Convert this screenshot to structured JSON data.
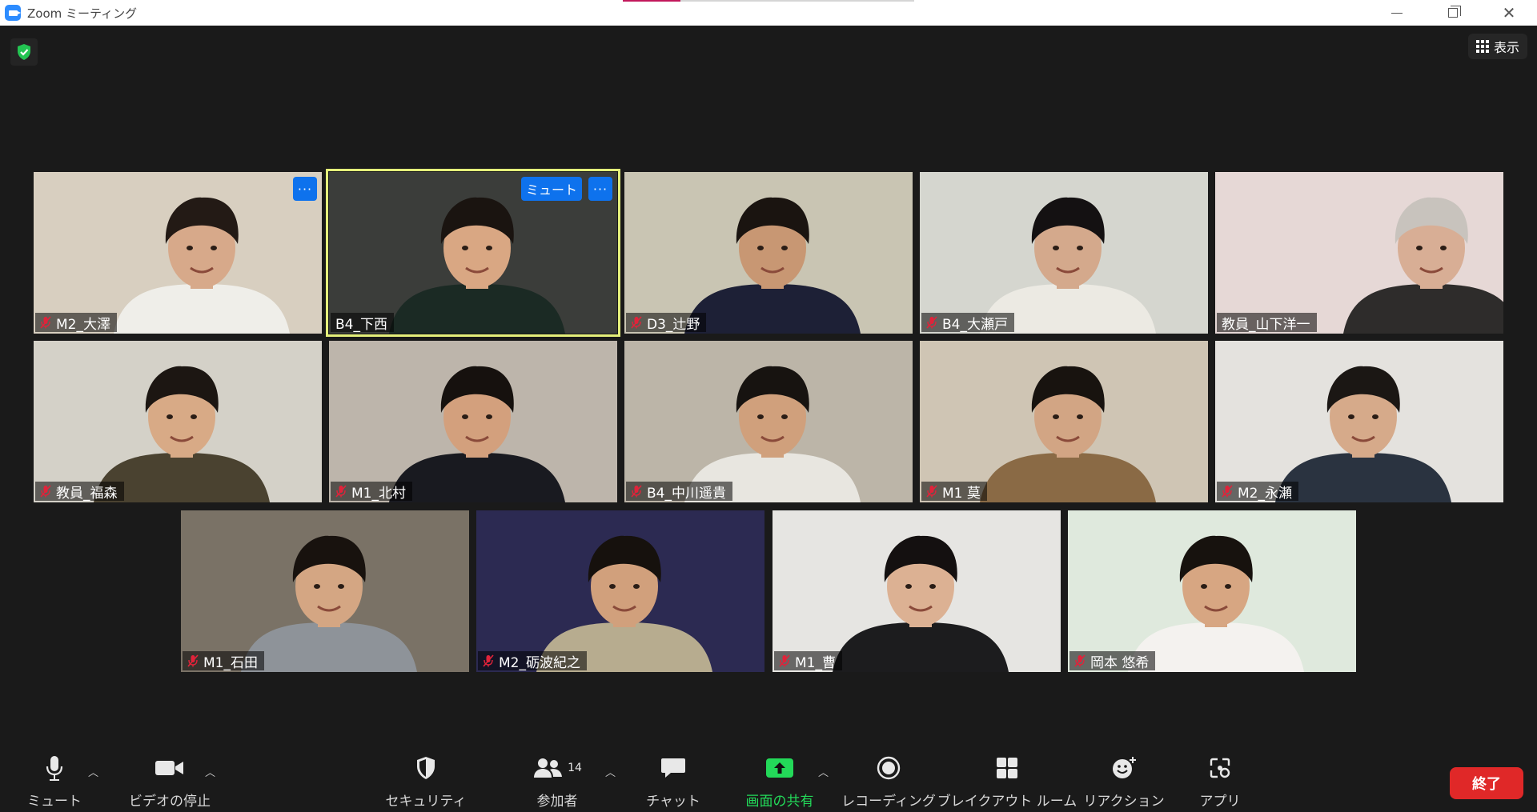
{
  "window": {
    "title": "Zoom ミーティング"
  },
  "top": {
    "view_label": "表示"
  },
  "participants": [
    {
      "name": "M2_大澤",
      "muted": true,
      "bg": "#d8cfc0",
      "shirt": "#efeee9",
      "skin": "#d7a98a",
      "hair": "#231a15"
    },
    {
      "name": "B4_下西",
      "muted": false,
      "bg": "#3b3d3a",
      "shirt": "#1b2a24",
      "skin": "#d9a783",
      "hair": "#1a1410"
    },
    {
      "name": "D3_辻野",
      "muted": true,
      "bg": "#c9c5b3",
      "shirt": "#1d2036",
      "skin": "#c89773",
      "hair": "#1a1410"
    },
    {
      "name": "B4_大瀬戸",
      "muted": true,
      "bg": "#d5d6cf",
      "shirt": "#eceae3",
      "skin": "#d4a98c",
      "hair": "#141112"
    },
    {
      "name": "教員_山下洋一",
      "muted": false,
      "bg": "#e6d8d6",
      "shirt": "#2e2c2b",
      "skin": "#d8ae95",
      "hair": "#c8c3bd"
    },
    {
      "name": "教員_福森",
      "muted": true,
      "bg": "#d4d1c8",
      "shirt": "#4a4230",
      "skin": "#d8aa86",
      "hair": "#1c1612"
    },
    {
      "name": "M1_北村",
      "muted": true,
      "bg": "#bdb5ab",
      "shirt": "#191a20",
      "skin": "#d3a07d",
      "hair": "#16110e"
    },
    {
      "name": "B4_中川遥貴",
      "muted": true,
      "bg": "#bcb5a8",
      "shirt": "#e8e6e0",
      "skin": "#d0a07c",
      "hair": "#171310"
    },
    {
      "name": "M1 莫",
      "muted": true,
      "bg": "#cfc5b4",
      "shirt": "#8a6a45",
      "skin": "#d2a584",
      "hair": "#18130f"
    },
    {
      "name": "M2_永瀬",
      "muted": true,
      "bg": "#e4e2de",
      "shirt": "#2a3340",
      "skin": "#d6aa8a",
      "hair": "#1b1714"
    },
    {
      "name": "M1_石田",
      "muted": true,
      "bg": "#7a7266",
      "shirt": "#8e9399",
      "skin": "#d4a683",
      "hair": "#18120e"
    },
    {
      "name": "M2_砺波紀之",
      "muted": true,
      "bg": "#2c2a52",
      "shirt": "#b7ac8f",
      "skin": "#d1a07c",
      "hair": "#16110d"
    },
    {
      "name": "M1_曹",
      "muted": true,
      "bg": "#e6e5e2",
      "shirt": "#1c1c1e",
      "skin": "#dcb193",
      "hair": "#141010"
    },
    {
      "name": "岡本 悠希",
      "muted": true,
      "bg": "#dfe9dd",
      "shirt": "#f4f2ef",
      "skin": "#d7a682",
      "hair": "#17120e"
    }
  ],
  "active_tile": {
    "mute_label": "ミュート",
    "more_label": "···"
  },
  "toolbar": {
    "mute_label": "ミュート",
    "video_label": "ビデオの停止",
    "security_label": "セキュリティ",
    "participants_label": "参加者",
    "participants_count": "14",
    "chat_label": "チャット",
    "share_label": "画面の共有",
    "record_label": "レコーディング",
    "breakout_label": "ブレイクアウト ルーム",
    "reactions_label": "リアクション",
    "apps_label": "アプリ",
    "end_label": "終了"
  },
  "colors": {
    "background": "#1a1a1a",
    "accent_blue": "#0e72ed",
    "share_green": "#23d959",
    "end_red": "#e02828",
    "active_border": "#e4ef7a"
  }
}
